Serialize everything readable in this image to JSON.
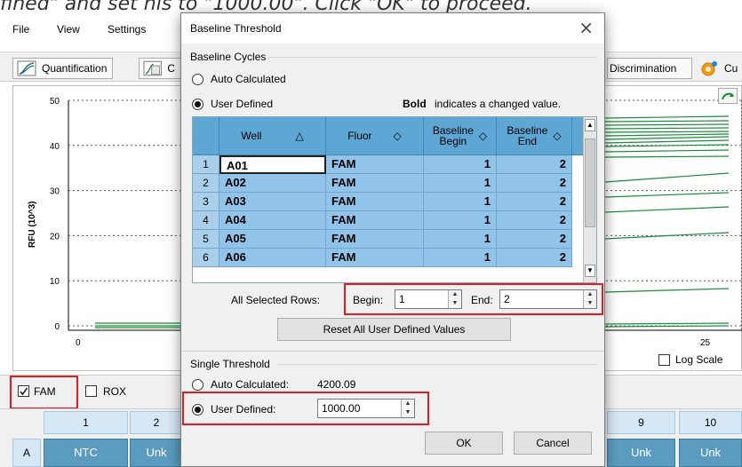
{
  "instruction": "fined\" and set his to \"1000.00\". Click \"OK\" to proceed.",
  "menu": [
    "File",
    "View",
    "Settings"
  ],
  "toolbar": {
    "quantification": "Quantification",
    "partial_c": "C",
    "discrimination": "Discrimination",
    "partial_cu": "Cu"
  },
  "chart": {
    "ylabel": "RFU (10^3)",
    "yticks": [
      "50",
      "40",
      "30",
      "20",
      "10",
      "0"
    ],
    "xticks": [
      "0",
      "25"
    ],
    "log_scale_label": "Log Scale"
  },
  "legend": {
    "fam": "FAM",
    "rox": "ROX",
    "fam_checked": true,
    "rox_checked": false
  },
  "plate": {
    "columns": [
      "1",
      "2",
      "9",
      "10"
    ],
    "row_label": "A",
    "wells": [
      "NTC",
      "Unk",
      "Unk",
      "Unk"
    ]
  },
  "dialog": {
    "title": "Baseline Threshold",
    "close_glyph": "×",
    "baseline_cycles_label": "Baseline Cycles",
    "auto_calculated": "Auto Calculated",
    "user_defined": "User Defined",
    "bold_word": "Bold",
    "bold_note": "indicates a changed value.",
    "table": {
      "headers": [
        "Well",
        "Fluor",
        "Baseline Begin",
        "Baseline End"
      ],
      "sort_glyphs": [
        "△",
        "◇",
        "◇",
        "◇"
      ],
      "rows": [
        {
          "index": "1",
          "well": "A01",
          "fluor": "FAM",
          "begin": "1",
          "end": "2"
        },
        {
          "index": "2",
          "well": "A02",
          "fluor": "FAM",
          "begin": "1",
          "end": "2"
        },
        {
          "index": "3",
          "well": "A03",
          "fluor": "FAM",
          "begin": "1",
          "end": "2"
        },
        {
          "index": "4",
          "well": "A04",
          "fluor": "FAM",
          "begin": "1",
          "end": "2"
        },
        {
          "index": "5",
          "well": "A05",
          "fluor": "FAM",
          "begin": "1",
          "end": "2"
        },
        {
          "index": "6",
          "well": "A06",
          "fluor": "FAM",
          "begin": "1",
          "end": "2"
        }
      ]
    },
    "all_selected_rows_label": "All Selected Rows:",
    "begin_label": "Begin:",
    "begin_value": "1",
    "end_label": "End:",
    "end_value": "2",
    "reset_button": "Reset All User Defined Values",
    "single_threshold_label": "Single Threshold",
    "threshold_auto_label": "Auto Calculated:",
    "threshold_auto_value": "4200.09",
    "threshold_user_label": "User Defined:",
    "threshold_user_value": "1000.00",
    "ok_button": "OK",
    "cancel_button": "Cancel"
  },
  "colors": {
    "highlight_red": "#e11d24",
    "grid_header": "#5ea6d4",
    "grid_cell": "#92c4ea",
    "curve_green": "#1a8c3a"
  }
}
